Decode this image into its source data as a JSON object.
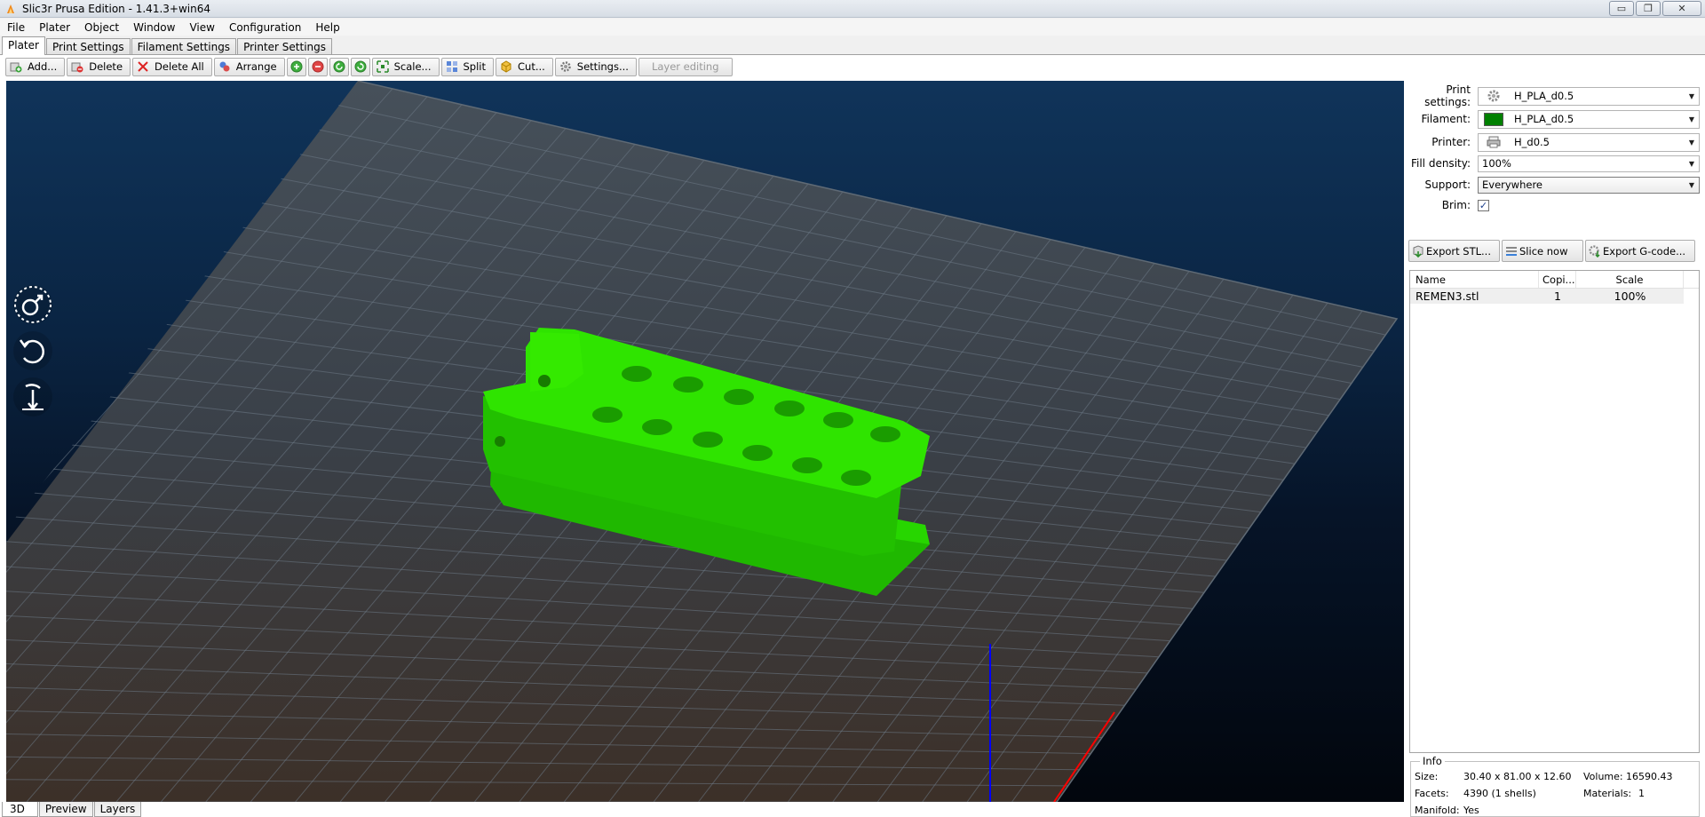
{
  "window": {
    "title": "Slic3r Prusa Edition - 1.41.3+win64",
    "buttons": {
      "minimize": "▭",
      "maximize": "❐",
      "close": "✕"
    }
  },
  "menu": [
    "File",
    "Plater",
    "Object",
    "Window",
    "View",
    "Configuration",
    "Help"
  ],
  "tabs": [
    "Plater",
    "Print Settings",
    "Filament Settings",
    "Printer Settings"
  ],
  "toolbar": {
    "add": "Add...",
    "delete": "Delete",
    "delete_all": "Delete All",
    "arrange": "Arrange",
    "scale": "Scale...",
    "split": "Split",
    "cut": "Cut...",
    "settings": "Settings...",
    "layer_editing": "Layer editing"
  },
  "settings": {
    "print_label": "Print settings:",
    "print_value": "H_PLA_d0.5",
    "filament_label": "Filament:",
    "filament_value": "H_PLA_d0.5",
    "filament_color": "#008000",
    "printer_label": "Printer:",
    "printer_value": "H_d0.5",
    "fill_label": "Fill density:",
    "fill_value": "100%",
    "support_label": "Support:",
    "support_value": "Everywhere",
    "brim_label": "Brim:",
    "brim_checked": "✓"
  },
  "actions": {
    "export_stl": "Export STL...",
    "slice_now": "Slice now",
    "export_gcode": "Export G-code..."
  },
  "objects": {
    "headers": {
      "name": "Name",
      "copies": "Copi...",
      "scale": "Scale"
    },
    "rows": [
      {
        "name": "REMEN3.stl",
        "copies": "1",
        "scale": "100%"
      }
    ]
  },
  "info": {
    "title": "Info",
    "size_label": "Size:",
    "size_value": "30.40 x 81.00 x 12.60",
    "volume_label": "Volume:",
    "volume_value": "16590.43",
    "facets_label": "Facets:",
    "facets_value": "4390 (1 shells)",
    "materials_label": "Materials:",
    "materials_value": "1",
    "manifold_label": "Manifold:",
    "manifold_value": "Yes"
  },
  "view_tabs": [
    "3D",
    "Preview",
    "Layers"
  ],
  "colors": {
    "model": "#22dd00",
    "bed": "#3b4650",
    "x_axis": "#ff0000",
    "z_axis": "#0000ff"
  }
}
